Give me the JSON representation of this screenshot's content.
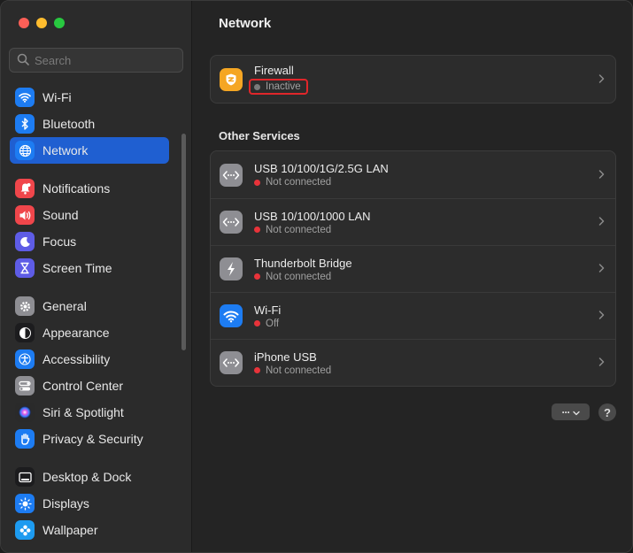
{
  "sidebar": {
    "search_placeholder": "Search",
    "groups": [
      [
        {
          "label": "Wi-Fi",
          "icon": "wifi-icon",
          "color": "#1d7cf2"
        },
        {
          "label": "Bluetooth",
          "icon": "bluetooth-icon",
          "color": "#1d7cf2"
        },
        {
          "label": "Network",
          "icon": "globe-icon",
          "color": "#1d7cf2",
          "selected": true
        }
      ],
      [
        {
          "label": "Notifications",
          "icon": "bell-icon",
          "color": "#f0464b"
        },
        {
          "label": "Sound",
          "icon": "speaker-icon",
          "color": "#f0464b"
        },
        {
          "label": "Focus",
          "icon": "moon-icon",
          "color": "#5e5ce6"
        },
        {
          "label": "Screen Time",
          "icon": "hourglass-icon",
          "color": "#5e5ce6"
        }
      ],
      [
        {
          "label": "General",
          "icon": "gear-icon",
          "color": "#8e8e93"
        },
        {
          "label": "Appearance",
          "icon": "appearance-icon",
          "color": "#1c1c1e"
        },
        {
          "label": "Accessibility",
          "icon": "accessibility-icon",
          "color": "#1d7cf2"
        },
        {
          "label": "Control Center",
          "icon": "toggles-icon",
          "color": "#8e8e93"
        },
        {
          "label": "Siri & Spotlight",
          "icon": "siri-icon",
          "color": "#2a2a2a"
        },
        {
          "label": "Privacy & Security",
          "icon": "hand-icon",
          "color": "#1d7cf2"
        }
      ],
      [
        {
          "label": "Desktop & Dock",
          "icon": "dock-icon",
          "color": "#1c1c1e"
        },
        {
          "label": "Displays",
          "icon": "sun-icon",
          "color": "#1d7cf2"
        },
        {
          "label": "Wallpaper",
          "icon": "flower-icon",
          "color": "#1d9bf0"
        }
      ]
    ]
  },
  "main": {
    "title": "Network",
    "firewall": {
      "title": "Firewall",
      "status": "Inactive",
      "status_color": "#7a7a7a",
      "icon_color": "#f5a623"
    },
    "other_services_title": "Other Services",
    "services": [
      {
        "title": "USB 10/100/1G/2.5G LAN",
        "status": "Not connected",
        "status_color": "#e8333a",
        "icon": "ethernet-icon"
      },
      {
        "title": "USB 10/100/1000 LAN",
        "status": "Not connected",
        "status_color": "#e8333a",
        "icon": "ethernet-icon"
      },
      {
        "title": "Thunderbolt Bridge",
        "status": "Not connected",
        "status_color": "#e8333a",
        "icon": "thunderbolt-icon"
      },
      {
        "title": "Wi-Fi",
        "status": "Off",
        "status_color": "#e8333a",
        "icon": "wifi-icon"
      },
      {
        "title": "iPhone USB",
        "status": "Not connected",
        "status_color": "#e8333a",
        "icon": "ethernet-icon"
      }
    ],
    "more_button_label": "···",
    "help_button_label": "?"
  }
}
